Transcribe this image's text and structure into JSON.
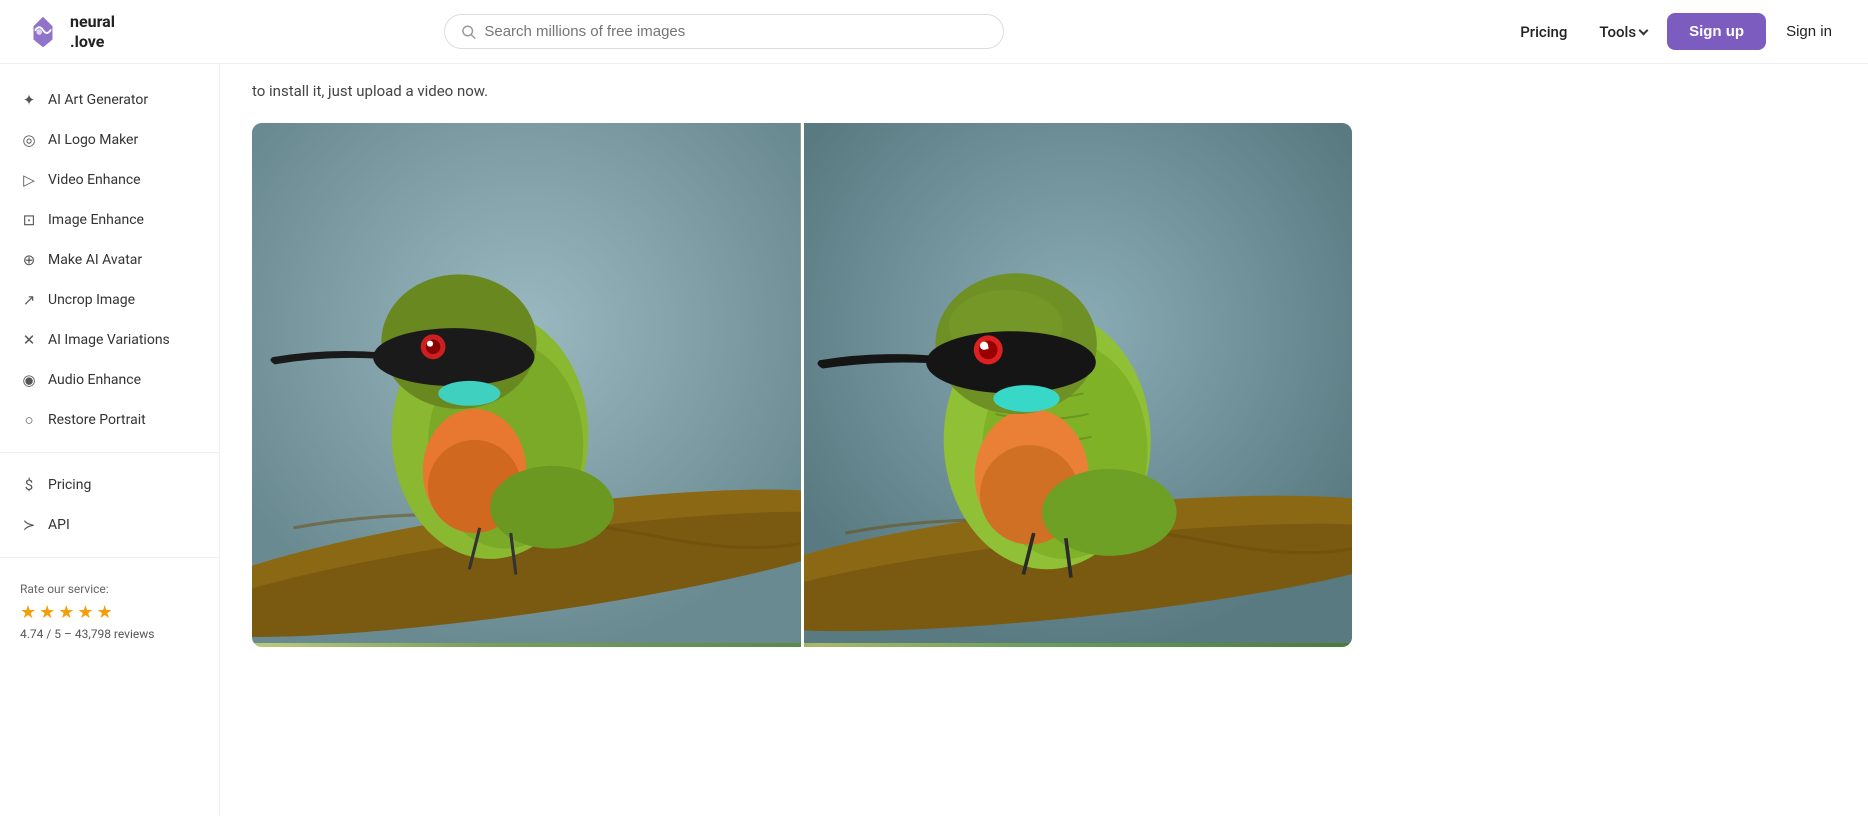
{
  "header": {
    "logo_name": "neural",
    "logo_suffix": ".love",
    "search_placeholder": "Search millions of free images",
    "nav_pricing": "Pricing",
    "nav_tools": "Tools",
    "btn_signup": "Sign up",
    "btn_signin": "Sign in"
  },
  "sidebar": {
    "items": [
      {
        "id": "ai-art-generator",
        "label": "AI Art Generator",
        "icon": "✦"
      },
      {
        "id": "ai-logo-maker",
        "label": "AI Logo Maker",
        "icon": "◎"
      },
      {
        "id": "video-enhance",
        "label": "Video Enhance",
        "icon": "▷"
      },
      {
        "id": "image-enhance",
        "label": "Image Enhance",
        "icon": "⊡"
      },
      {
        "id": "make-ai-avatar",
        "label": "Make AI Avatar",
        "icon": "⊕"
      },
      {
        "id": "uncrop-image",
        "label": "Uncrop Image",
        "icon": "↗"
      },
      {
        "id": "ai-image-variations",
        "label": "AI Image Variations",
        "icon": "✕"
      },
      {
        "id": "audio-enhance",
        "label": "Audio Enhance",
        "icon": "◉"
      },
      {
        "id": "restore-portrait",
        "label": "Restore Portrait",
        "icon": "○"
      }
    ],
    "bottom_items": [
      {
        "id": "pricing",
        "label": "Pricing",
        "icon": "$"
      },
      {
        "id": "api",
        "label": "API",
        "icon": "≻"
      }
    ],
    "rating": {
      "label": "Rate our service:",
      "score": "4.74",
      "max": "5",
      "reviews": "43,798",
      "reviews_text": "4.74 / 5 – 43,798 reviews",
      "stars": [
        true,
        true,
        true,
        true,
        true
      ]
    }
  },
  "main": {
    "top_text": "to install it, just upload a video now.",
    "image_left_alt": "Bird image - original",
    "image_right_alt": "Bird image - enhanced"
  }
}
